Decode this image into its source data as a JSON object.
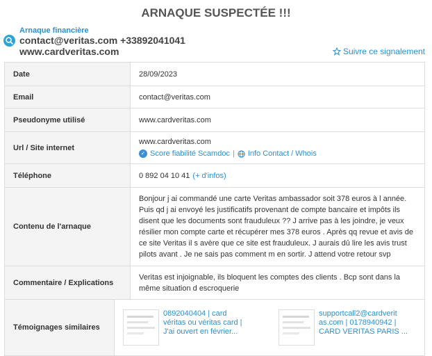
{
  "page": {
    "title": "ARNAQUE SUSPECTÉE !!!",
    "category": "Arnaque financière",
    "contact_line": "contact@veritas.com +33892041041",
    "site_line": "www.cardveritas.com",
    "follow_label": "Suivre ce signalement"
  },
  "rows": {
    "date": {
      "label": "Date",
      "value": "28/09/2023"
    },
    "email": {
      "label": "Email",
      "value": "contact@veritas.com"
    },
    "pseudo": {
      "label": "Pseudonyme utilisé",
      "value": "www.cardveritas.com"
    },
    "url": {
      "label": "Url / Site internet",
      "value": "www.cardveritas.com",
      "score_link": "Score fiabilité Scamdoc",
      "separator": "|",
      "info_link": "Info Contact / Whois"
    },
    "phone": {
      "label": "Téléphone",
      "value": "0 892 04 10 41",
      "more_link": "(+ d'infos)"
    },
    "content": {
      "label": "Contenu de l'arnaque",
      "lines": [
        "Bonjour j ai commandé une carte Veritas ambassador soit 378 euros à l année.",
        "Puis qd j ai envoyé les justificatifs provenant de compte bancaire et impôts ils",
        "disent que les documents sont frauduleux ?? J arrive pas à les joindre, je veux",
        "résilier mon compte carte et récupérer mes 378 euros . Après qq revue et avis de",
        "ce site Veritas il s avère que ce site est frauduleux. J aurais dû lire les avis trust",
        "pilots avant . Je ne sais pas comment m en sortir. J attend votre retour svp"
      ]
    },
    "comment": {
      "label": "Commentaire / Explications",
      "lines": [
        "Veritas est injoignable, ils bloquent les comptes des clients . Bcp sont dans la",
        "même situation d escroquerie"
      ]
    },
    "similar": {
      "label": "Témoignages similaires",
      "items": [
        {
          "lines": [
            "0892040404 | card",
            "véritas ou véritas card |",
            "J'ai ouvert en février..."
          ]
        },
        {
          "lines": [
            "supportcall2@cardverit",
            "as.com | 0178940942 |",
            "CARD VERITAS PARIS ..."
          ]
        }
      ]
    }
  },
  "colors": {
    "accent": "#2a8fd0",
    "label_bg": "#f4f4f4",
    "border": "#dcdcdc"
  },
  "icons": {
    "header": "search-icon",
    "follow": "star-outline-icon",
    "score": "shield-icon",
    "info": "globe-icon"
  }
}
